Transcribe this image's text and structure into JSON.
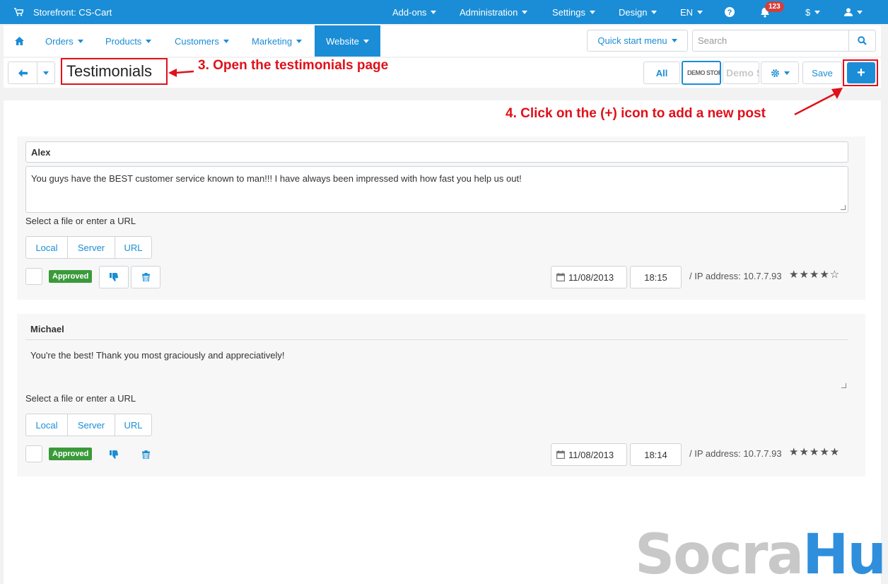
{
  "topbar": {
    "store_label": "Storefront: CS-Cart",
    "menus": [
      "Add-ons",
      "Administration",
      "Settings",
      "Design",
      "EN"
    ],
    "notifications_count": "123",
    "currency": "$"
  },
  "navbar": {
    "items": [
      "Orders",
      "Products",
      "Customers",
      "Marketing",
      "Website"
    ],
    "active": "Website",
    "quick_start_label": "Quick start menu",
    "search_placeholder": "Search"
  },
  "actionbar": {
    "title": "Testimonials",
    "all_label": "All",
    "store_logo_1": "DEMO STORE",
    "store_logo_2": "Demo Sto",
    "save_label": "Save",
    "add_label": "+"
  },
  "annotations": {
    "step3": "3. Open the testimonials page",
    "step4": "4. Click on the (+) icon to add a new post"
  },
  "posts": [
    {
      "name": "Alex",
      "message": "You guys have the BEST customer service known to man!!! I have always been impressed with how fast you help us out!",
      "file_label": "Select a file or enter a URL",
      "tabs": [
        "Local",
        "Server",
        "URL"
      ],
      "status": "Approved",
      "date": "11/08/2013",
      "time": "18:15",
      "ip": "/ IP address: 10.7.7.93",
      "rating": 4
    },
    {
      "name": "Michael",
      "message": "You're the best! Thank you most graciously and appreciatively!",
      "file_label": "Select a file or enter a URL",
      "tabs": [
        "Local",
        "Server",
        "URL"
      ],
      "status": "Approved",
      "date": "11/08/2013",
      "time": "18:14",
      "ip": "/ IP address: 10.7.7.93",
      "rating": 5
    }
  ],
  "watermark": {
    "part1": "Socra",
    "part2": "Hub"
  },
  "colors": {
    "primary": "#1a8dd6",
    "annotation": "#e0101a",
    "approved": "#3a9a3a",
    "badge": "#d43f3a"
  }
}
